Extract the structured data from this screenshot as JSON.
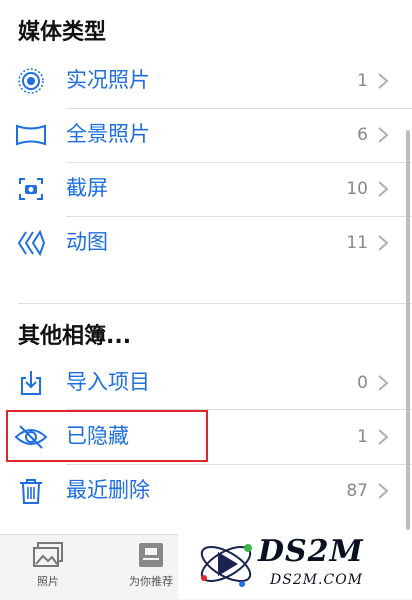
{
  "media_types": {
    "title": "媒体类型",
    "items": [
      {
        "label": "实况照片",
        "count": "1",
        "icon": "live-photo-icon"
      },
      {
        "label": "全景照片",
        "count": "6",
        "icon": "panorama-icon"
      },
      {
        "label": "截屏",
        "count": "10",
        "icon": "screenshot-icon"
      },
      {
        "label": "动图",
        "count": "11",
        "icon": "animated-icon"
      }
    ]
  },
  "other_albums": {
    "title": "其他相簿...",
    "items": [
      {
        "label": "导入项目",
        "count": "0",
        "icon": "import-icon"
      },
      {
        "label": "已隐藏",
        "count": "1",
        "icon": "hidden-eye-icon"
      },
      {
        "label": "最近删除",
        "count": "87",
        "icon": "trash-icon"
      }
    ]
  },
  "tabbar": {
    "tabs": [
      {
        "label": "照片",
        "icon": "photos-icon"
      },
      {
        "label": "为你推荐",
        "icon": "for-you-icon"
      }
    ]
  },
  "watermark": {
    "title": "DS2M",
    "subtitle": "DS2M.COM"
  },
  "colors": {
    "accent": "#1f6fe0",
    "highlight": "#e0262c",
    "count": "#888888"
  }
}
